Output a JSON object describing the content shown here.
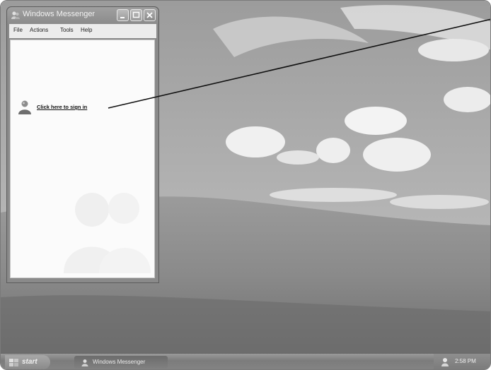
{
  "window": {
    "title": "Windows Messenger",
    "menu": [
      "File",
      "Actions",
      "Tools",
      "Help"
    ],
    "signin_link": "Click here to sign in"
  },
  "taskbar": {
    "start_label": "start",
    "task_label": "Windows Messenger",
    "clock": "2:58 PM"
  },
  "icons": {
    "title": "messenger-buddy-icon",
    "user": "messenger-user-icon",
    "start": "windows-flag-icon",
    "tray": "messenger-tray-icon"
  },
  "colors": {
    "link": "#111111",
    "taskbar": "#848484",
    "title_bar": "#8b8b8b"
  }
}
